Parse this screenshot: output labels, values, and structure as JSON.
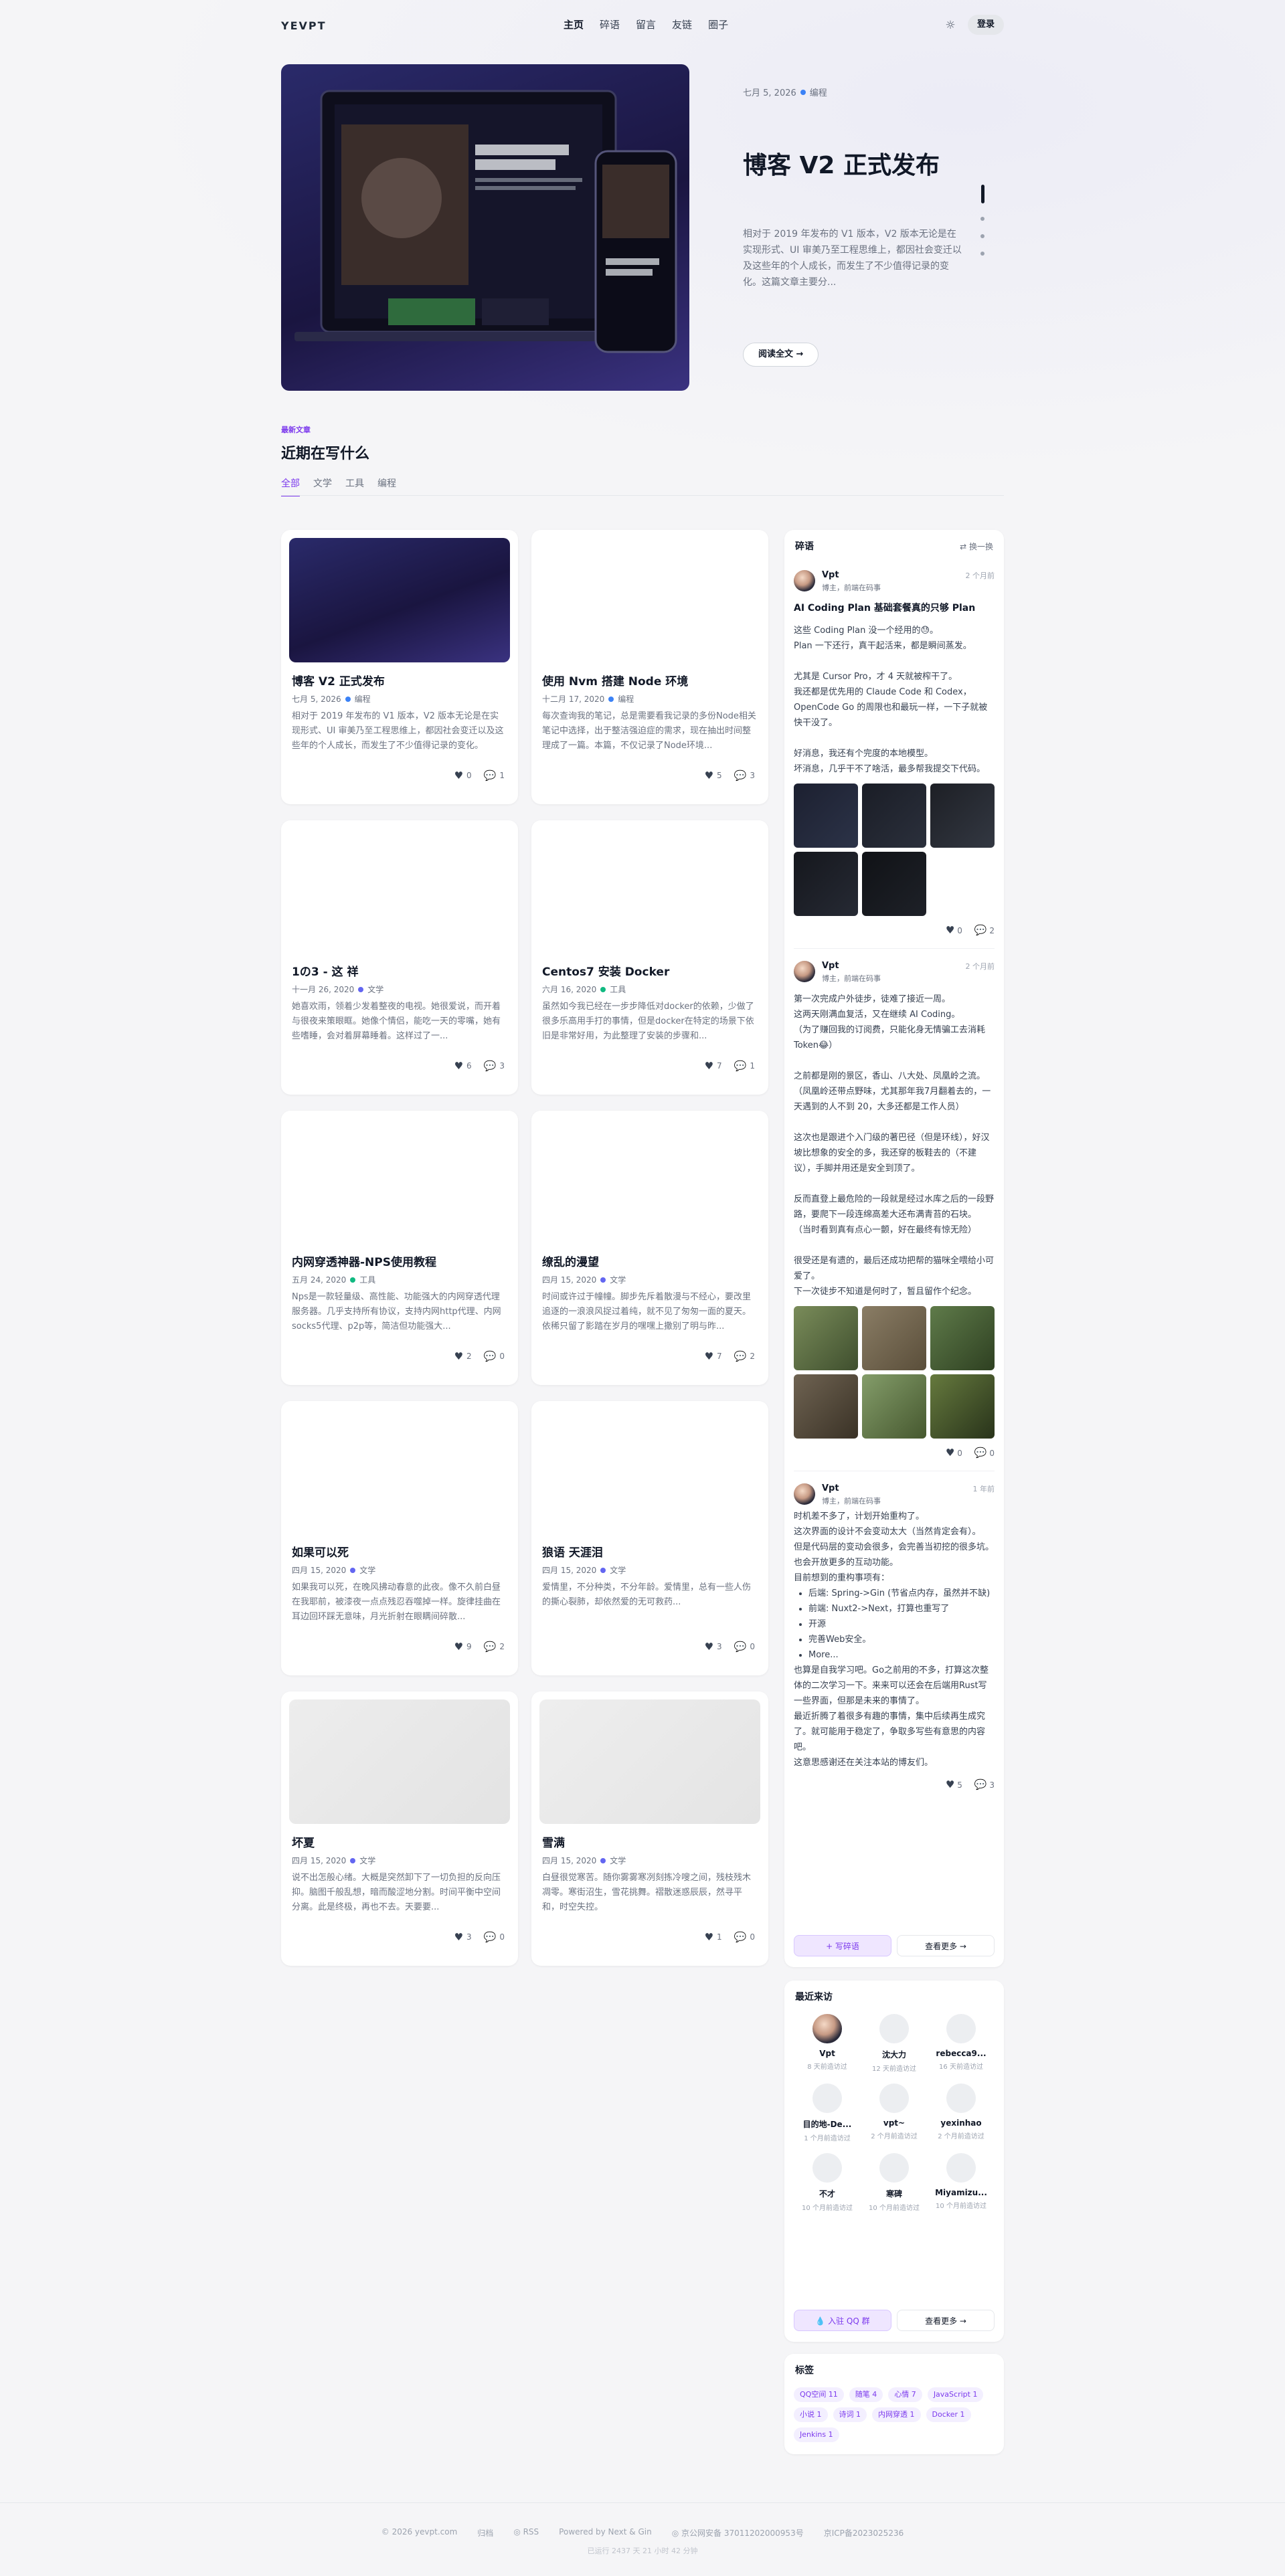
{
  "header": {
    "logo": "YEVPT",
    "nav": [
      "主页",
      "碎语",
      "留言",
      "友链",
      "圈子"
    ],
    "login": "登录",
    "theme_icon": "sun-icon"
  },
  "hero": {
    "date": "七月 5, 2026",
    "category": "编程",
    "title": "博客 V2 正式发布",
    "desc": "相对于 2019 年发布的 V1 版本，V2 版本无论是在实现形式、UI 审美乃至工程思维上，都因社会变迁以及这些年的个人成长，而发生了不少值得记录的变化。这篇文章主要分...",
    "button": "阅读全文 →"
  },
  "section": {
    "tag": "最新文章",
    "title": "近期在写什么",
    "tabs": [
      "全部",
      "文学",
      "工具",
      "编程"
    ]
  },
  "cards": [
    {
      "title": "博客 V2 正式发布",
      "date": "七月 5, 2026",
      "cat": "编程",
      "dot": "#3b82f6",
      "desc": "相对于 2019 年发布的 V1 版本，V2 版本无论是在实现形式、UI 审美乃至工程思维上，都因社会变迁以及这些年的个人成长，而发生了不少值得记录的变化。",
      "likes": "0",
      "comments": "1"
    },
    {
      "title": "使用 Nvm 搭建 Node 环境",
      "date": "十二月 17, 2020",
      "cat": "编程",
      "dot": "#3b82f6",
      "desc": "每次查询我的笔记，总是需要看我记录的多份Node相关笔记中选择，出于整洁强迫症的需求，现在抽出时间整理成了一篇。本篇，不仅记录了Node环境...",
      "likes": "5",
      "comments": "3"
    },
    {
      "title": "1の3 - 这 祥",
      "date": "十一月 26, 2020",
      "cat": "文学",
      "dot": "#6366f1",
      "desc": "她喜欢雨，领着少发着整夜的电视。她很爱说，而开着与很夜来策眼眶。她像个情侣，能吃一天的零嘴，她有些嗜睡，会对着屏幕睡着。这样过了一...",
      "likes": "6",
      "comments": "3"
    },
    {
      "title": "Centos7 安装 Docker",
      "date": "六月 16, 2020",
      "cat": "工具",
      "dot": "#10b981",
      "desc": "虽然如今我已经在一步步降低对docker的依赖，少做了很多乐高用手打的事情，但是docker在特定的场景下依旧是非常好用，为此整理了安装的步骤和...",
      "likes": "7",
      "comments": "1"
    },
    {
      "title": "内网穿透神器-NPS使用教程",
      "date": "五月 24, 2020",
      "cat": "工具",
      "dot": "#10b981",
      "desc": "Nps是一款轻量级、高性能、功能强大的内网穿透代理服务器。几乎支持所有协议，支持内网http代理、内网socks5代理、p2p等，简洁但功能强大...",
      "likes": "2",
      "comments": "0"
    },
    {
      "title": "缭乱的漫望",
      "date": "四月 15, 2020",
      "cat": "文学",
      "dot": "#6366f1",
      "desc": "时间或许过于幢幢。脚步先斥着散漫与不经心，要改里追逐的一浪浪风捉过着纯，就不见了匆匆一面的夏天。依稀只留了影踏在岁月的嘿嘿上撒别了明与昨...",
      "likes": "7",
      "comments": "2"
    },
    {
      "title": "如果可以死",
      "date": "四月 15, 2020",
      "cat": "文学",
      "dot": "#6366f1",
      "desc": "如果我可以死，在晚风拂动春意的此夜。像不久前白昼在我耶前，被漆夜一点点残忍吞噬掉一样。旋律挂曲在耳边回环踩无意味，月光折射在眼瞒间碎散...",
      "likes": "9",
      "comments": "2"
    },
    {
      "title": "狼语 天涯泪",
      "date": "四月 15, 2020",
      "cat": "文学",
      "dot": "#6366f1",
      "desc": "爱情里，不分种类，不分年龄。爱情里，总有一些人伤的撕心裂肺，却依然爱的无可救药...",
      "likes": "3",
      "comments": "0"
    },
    {
      "title": "坏夏",
      "date": "四月 15, 2020",
      "cat": "文学",
      "dot": "#6366f1",
      "desc": "说不出怎般心绪。大概是突然卸下了一切负担的反向压抑。脑图千般乱想，暗而酸涩地分割。时间平衡中空间分离。此是终极，再也不去。天要要...",
      "likes": "3",
      "comments": "0"
    },
    {
      "title": "雪满",
      "date": "四月 15, 2020",
      "cat": "文学",
      "dot": "#6366f1",
      "desc": "白昼很觉寒苦。随你雾雾寒冽刻拣冷嗖之间，残枝残木凋零。寒街沼生，雪花挑舞。褶散迷惑辰辰，然寻平和，时空失控。",
      "likes": "1",
      "comments": "0"
    }
  ],
  "side": {
    "heading": "碎语",
    "switch": "⇄ 换一换",
    "posts": [
      {
        "name": "Vpt",
        "role": "博主，前端在码事",
        "time": "2 个月前",
        "title": "AI Coding Plan 基础套餐真的只够 Plan",
        "lines": [
          "这些 Coding Plan 没一个经用的😓。",
          "Plan 一下还行，真干起活来，都是瞬间蒸发。",
          "",
          "尤其是 Cursor Pro，才 4 天就被榨干了。",
          "我还都是优先用的 Claude Code 和 Codex，OpenCode Go 的周限也和最玩一样，一下子就被快干没了。",
          "",
          "好消息，我还有个完度的本地模型。",
          "坏消息，几乎干不了啥活，最多帮我提交下代码。"
        ],
        "likes": "0",
        "comments": "2"
      },
      {
        "name": "Vpt",
        "role": "博主，前端在码事",
        "time": "2 个月前",
        "lines": [
          "第一次完成户外徒步，徒难了接近一周。",
          "这两天刚满血复活，又在继续 AI Coding。",
          "（为了赚回我的订阅费，只能化身无情骗工去消耗Token😂）",
          "",
          "之前都是刚的景区，香山、八大处、凤凰岭之流。",
          "（凤凰岭还带点野味，尤其那年我7月翻着去的，一天遇到的人不到 20，大多还都是工作人员）",
          "",
          "这次也是跟进个入门级的著巴径（但是环线），好汉坡比想象的安全的多，我还穿的板鞋去的（不建议），手脚并用还是安全到顶了。",
          "",
          "反而直登上最危险的一段就是经过水库之后的一段野路，要爬下一段连绵高差大还布满青苔的石块。",
          "（当时看到真有点心一颤，好在最终有惊无险）",
          "",
          "很受还是有遗的，最后还成功把帮的猫咪全喂给小可爱了。",
          "下一次徒步不知道是何时了，暂且留作个纪念。"
        ],
        "likes": "0",
        "comments": "0"
      },
      {
        "name": "Vpt",
        "role": "博主，前端在码事",
        "time": "1 年前",
        "lines": [
          "时机差不多了，计划开始重构了。",
          "这次界面的设计不会变动太大（当然肯定会有）。",
          "但是代码层的变动会很多，会完善当初挖的很多坑。也会开放更多的互动功能。",
          "目前想到的重构事项有："
        ],
        "bullets": [
          "后端: Spring->Gin (节省点内存，虽然并不缺)",
          "前端: Nuxt2->Next，打算也重写了",
          "开源",
          "完善Web安全。",
          "More..."
        ],
        "lines2": [
          "也算是自我学习吧。Go之前用的不多，打算这次整体的二次学习一下。来来可以还会在后端用Rust写一些界面，但那是未来的事情了。",
          "最近折腾了着很多有趣的事情，集中后续再生成究了。就可能用于稳定了，争取多写些有意思的内容吧。",
          "这意思感谢还在关注本站的博友们。"
        ],
        "likes": "5",
        "comments": "3"
      }
    ],
    "btn_write": "+ 写碎语",
    "btn_more": "查看更多 →"
  },
  "visitors": {
    "heading": "最近来访",
    "items": [
      {
        "name": "Vpt",
        "time": "8 天前造访过"
      },
      {
        "name": "沈大力",
        "time": "12 天前造访过"
      },
      {
        "name": "rebecca9...",
        "time": "16 天前造访过"
      },
      {
        "name": "目的地-De...",
        "time": "1 个月前造访过"
      },
      {
        "name": "vpt~",
        "time": "2 个月前造访过"
      },
      {
        "name": "yexinhao",
        "time": "2 个月前造访过"
      },
      {
        "name": "不才",
        "time": "10 个月前造访过"
      },
      {
        "name": "寒碑",
        "time": "10 个月前造访过"
      },
      {
        "name": "Miyamizu...",
        "time": "10 个月前造访过"
      }
    ],
    "btn_join": "💧 入驻 QQ 群",
    "btn_more": "查看更多 →"
  },
  "tags": {
    "heading": "标签",
    "items": [
      "QQ空间 11",
      "随笔 4",
      "心情 7",
      "JavaScript 1",
      "小说 1",
      "诗词 1",
      "内网穿透 1",
      "Docker 1",
      "Jenkins 1"
    ]
  },
  "footer": {
    "items": [
      "© 2026 yevpt.com",
      "归档",
      "◎ RSS",
      "Powered by Next & Gin",
      "◎ 京公网安备 37011202000953号",
      "京ICP备2023025236"
    ],
    "line2": "已运行 2437 天 21 小时 42 分钟"
  }
}
